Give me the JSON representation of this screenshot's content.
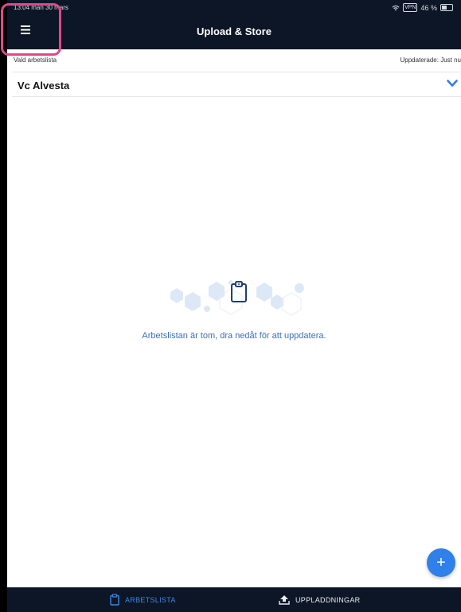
{
  "status_bar": {
    "time_date": "13:04  mån 30 mars",
    "vpn": "VPN",
    "battery": "46 %"
  },
  "navbar": {
    "title": "Upload & Store",
    "menu_icon": "hamburger-menu-icon"
  },
  "worklist": {
    "label": "Vald arbetslista",
    "updated": "Uppdaterade: Just nu",
    "selected": "Vc Alvesta"
  },
  "empty_state": {
    "message": "Arbetslistan är tom, dra nedåt för att uppdatera.",
    "icon": "clipboard-icon"
  },
  "fab": {
    "label": "+"
  },
  "tabs": [
    {
      "label": "ARBETSLISTA",
      "icon": "clipboard-icon",
      "active": true
    },
    {
      "label": "UPPLADDNINGAR",
      "icon": "upload-icon",
      "active": false
    }
  ],
  "colors": {
    "navbar_bg": "#0d1626",
    "accent": "#3d85e6",
    "highlight": "#e0488a"
  }
}
